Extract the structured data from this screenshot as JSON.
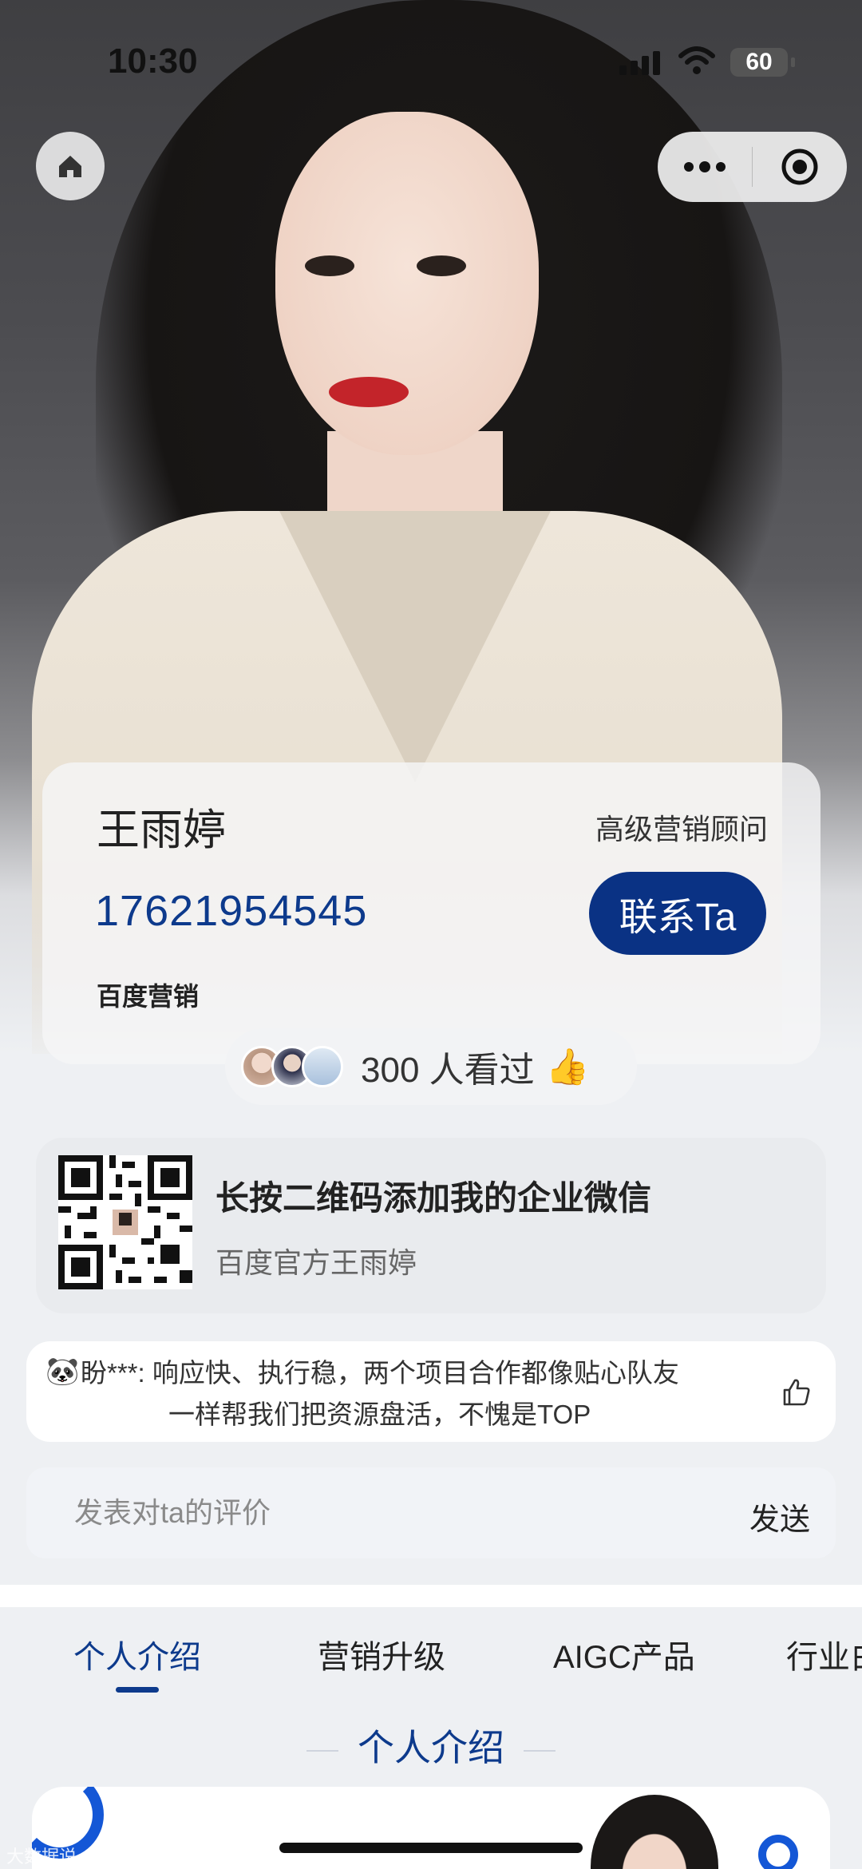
{
  "status_bar": {
    "time": "10:30",
    "battery": "60"
  },
  "profile": {
    "name": "王雨婷",
    "title": "高级营销顾问",
    "phone": "17621954545",
    "contact_button": "联系Ta",
    "company": "百度营销"
  },
  "viewers": {
    "text": "300 人看过",
    "emoji": "👍"
  },
  "qr_card": {
    "title": "长按二维码添加我的企业微信",
    "subtitle": "百度官方王雨婷"
  },
  "comment": {
    "icon": "🐼",
    "line1": "盼***: 响应快、执行稳，两个项目合作都像贴心队友",
    "line2": "一样帮我们把资源盘活，不愧是TOP"
  },
  "review_input": {
    "placeholder": "发表对ta的评价",
    "send_label": "发送"
  },
  "tabs": [
    {
      "label": "个人介绍"
    },
    {
      "label": "营销升级"
    },
    {
      "label": "AIGC产品"
    },
    {
      "label": "行业白"
    }
  ],
  "section_title": "个人介绍",
  "watermark": "大数据说",
  "colors": {
    "brand_blue": "#0a3284",
    "accent_blue": "#1457d6",
    "lip_red": "#c3242a"
  }
}
